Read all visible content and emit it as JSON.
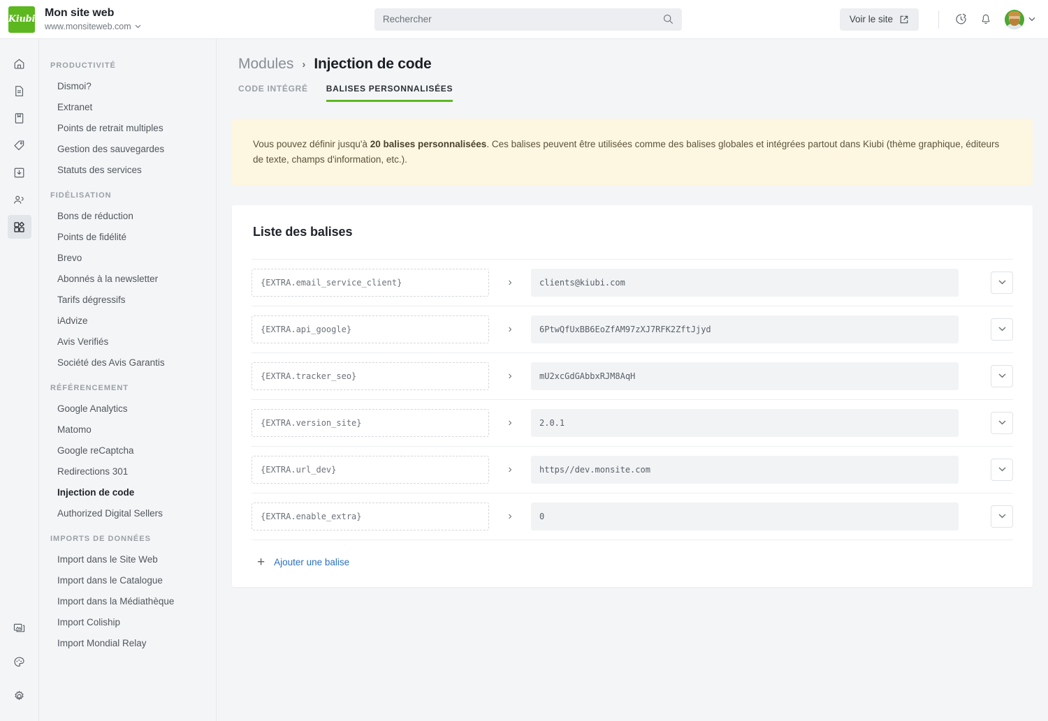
{
  "header": {
    "logo_text": "Kiubi",
    "site_title": "Mon site web",
    "site_url": "www.monsiteweb.com",
    "site_url_caret": "⌄",
    "search": {
      "placeholder": "Rechercher",
      "value": ""
    },
    "view_site_label": "Voir le site",
    "icons": [
      "external-link-icon",
      "history-icon",
      "bell-icon",
      "avatar",
      "chevron-down-icon"
    ]
  },
  "rail": {
    "items": [
      {
        "name": "home-icon",
        "active": false
      },
      {
        "name": "pages-icon",
        "active": false
      },
      {
        "name": "catalog-icon",
        "active": false
      },
      {
        "name": "tag-icon",
        "active": false
      },
      {
        "name": "orders-icon",
        "active": false
      },
      {
        "name": "members-icon",
        "active": false
      },
      {
        "name": "modules-icon",
        "active": true
      }
    ],
    "bottom": [
      {
        "name": "media-icon"
      },
      {
        "name": "theme-icon"
      },
      {
        "name": "settings-icon"
      }
    ]
  },
  "sidebar": {
    "groups": [
      {
        "title": "PRODUCTIVITÉ",
        "items": [
          {
            "label": "Dismoi?",
            "active": false
          },
          {
            "label": "Extranet",
            "active": false
          },
          {
            "label": "Points de retrait multiples",
            "active": false
          },
          {
            "label": "Gestion des sauvegardes",
            "active": false
          },
          {
            "label": "Statuts des services",
            "active": false
          }
        ]
      },
      {
        "title": "FIDÉLISATION",
        "items": [
          {
            "label": "Bons de réduction",
            "active": false
          },
          {
            "label": "Points de fidélité",
            "active": false
          },
          {
            "label": "Brevo",
            "active": false
          },
          {
            "label": "Abonnés à la newsletter",
            "active": false
          },
          {
            "label": "Tarifs dégressifs",
            "active": false
          },
          {
            "label": "iAdvize",
            "active": false
          },
          {
            "label": "Avis Verifiés",
            "active": false
          },
          {
            "label": "Société des Avis Garantis",
            "active": false
          }
        ]
      },
      {
        "title": "RÉFÉRENCEMENT",
        "items": [
          {
            "label": "Google Analytics",
            "active": false
          },
          {
            "label": "Matomo",
            "active": false
          },
          {
            "label": "Google reCaptcha",
            "active": false
          },
          {
            "label": "Redirections 301",
            "active": false
          },
          {
            "label": "Injection de code",
            "active": true
          },
          {
            "label": "Authorized Digital Sellers",
            "active": false
          }
        ]
      },
      {
        "title": "IMPORTS DE DONNÉES",
        "items": [
          {
            "label": "Import dans le Site Web",
            "active": false
          },
          {
            "label": "Import dans le Catalogue",
            "active": false
          },
          {
            "label": "Import dans la Médiathèque",
            "active": false
          },
          {
            "label": "Import Coliship",
            "active": false
          },
          {
            "label": "Import Mondial Relay",
            "active": false
          }
        ]
      }
    ]
  },
  "main": {
    "breadcrumb": {
      "parent": "Modules",
      "separator": "›",
      "current": "Injection de code"
    },
    "tabs": [
      {
        "label": "CODE INTÉGRÉ",
        "active": false
      },
      {
        "label": "BALISES PERSONNALISÉES",
        "active": true
      }
    ],
    "notice": {
      "part1": "Vous pouvez définir jusqu'à ",
      "strong": "20 balises personnalisées",
      "part2": ". Ces balises peuvent être utilisées comme des balises globales et intégrées partout dans Kiubi (thème graphique, éditeurs de texte, champs d'information, etc.)."
    },
    "card": {
      "title": "Liste des balises",
      "rows": [
        {
          "key": "{EXTRA.email_service_client}",
          "arrow": "›",
          "value": "clients@kiubi.com"
        },
        {
          "key": "{EXTRA.api_google}",
          "arrow": "›",
          "value": "6PtwQfUxBB6EoZfAM97zXJ7RFK2ZftJjyd"
        },
        {
          "key": "{EXTRA.tracker_seo}",
          "arrow": "›",
          "value": "mU2xcGdGAbbxRJM8AqH"
        },
        {
          "key": "{EXTRA.version_site}",
          "arrow": "›",
          "value": "2.0.1"
        },
        {
          "key": "{EXTRA.url_dev}",
          "arrow": "›",
          "value": "https//dev.monsite.com"
        },
        {
          "key": "{EXTRA.enable_extra}",
          "arrow": "›",
          "value": "0"
        }
      ],
      "add_label": "Ajouter une balise",
      "add_plus": "+"
    }
  },
  "colors": {
    "accent_green": "#5cb81e",
    "link_blue": "#2a6fc0",
    "notice_bg": "#fdf6e0",
    "page_bg": "#f4f5f7"
  }
}
